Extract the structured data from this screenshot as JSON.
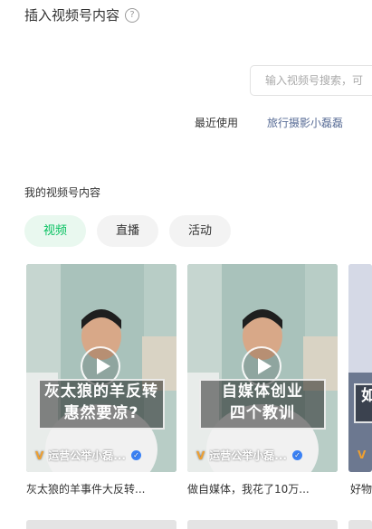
{
  "dialog": {
    "title": "插入视频号内容",
    "help_icon": "?"
  },
  "search": {
    "placeholder": "输入视频号搜索，可"
  },
  "recent": {
    "label": "最近使用",
    "link": "旅行摄影小磊磊"
  },
  "section": {
    "title": "我的视频号内容"
  },
  "tabs": [
    {
      "label": "视频",
      "active": true
    },
    {
      "label": "直播",
      "active": false
    },
    {
      "label": "活动",
      "active": false
    }
  ],
  "cards": [
    {
      "caption_line1": "灰太狼的羊反转",
      "caption_line2": "惠然要凉?",
      "author": "运营公举小磊...",
      "description": "灰太狼的羊事件大反转..."
    },
    {
      "caption_line1": "自媒体创业",
      "caption_line2": "四个教训",
      "author": "运营公举小磊...",
      "description": "做自媒体，我花了10万..."
    },
    {
      "caption_line1": "如",
      "author": "",
      "description": "好物"
    }
  ],
  "colors": {
    "accent": "#07c160",
    "link": "#576b95",
    "verified": "#3b82f6"
  }
}
